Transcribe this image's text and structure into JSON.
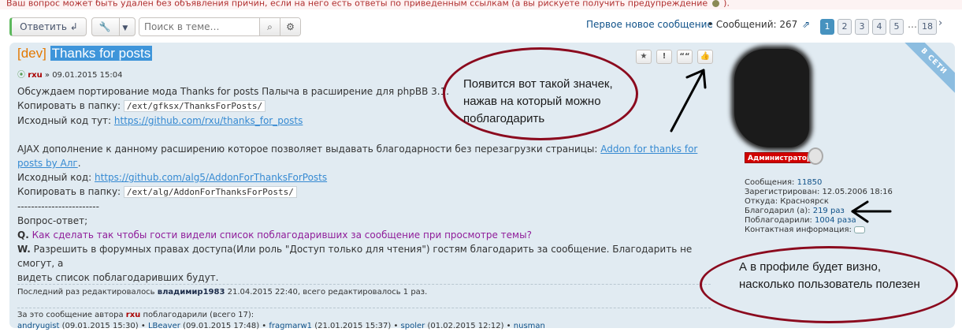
{
  "top_warning": {
    "text_before_icon": "Ваш вопрос может быть удален без объявления причин, если на него есть ответы по приведенным ссылкам (а вы рискуете получить предупреждение",
    "text_after_icon": ")."
  },
  "toolbar": {
    "reply_label": "Ответить",
    "search_placeholder": "Поиск в теме…"
  },
  "pagination": {
    "first_new": "Первое новое сообщение",
    "messages_label": "Сообщений: 267",
    "pages": [
      "1",
      "2",
      "3",
      "4",
      "5",
      "…",
      "18"
    ],
    "active_page": "1"
  },
  "post": {
    "title_prefix": "[dev]",
    "title": "Thanks for posts",
    "author": "rxu",
    "date": "» 09.01.2015 15:04",
    "online_badge": "В СЕТИ",
    "line1": "Обсуждаем портирование мода Thanks for posts Палыча в расширение для phpBB 3.1.",
    "copy_label_1": "Копировать в папку:",
    "copy_path_1": "/ext/gfksx/ThanksForPosts/",
    "source_label_1": "Исходный код тут:",
    "source_link_1": "https://github.com/rxu/thanks_for_posts",
    "ajax_text": "AJAX дополнение к данному расширению которое позволяет выдавать благодарности без перезагрузки страницы:",
    "ajax_link": "Addon for thanks for posts by Алг",
    "source_label_2": "Исходный код:",
    "source_link_2": "https://github.com/alg5/AddonForThanksForPosts",
    "copy_label_2": "Копировать в папку:",
    "copy_path_2": "/ext/alg/AddonForThanksForPosts/",
    "separator": "------------------------",
    "qa_title": "Вопрос-ответ;",
    "q_prefix": "Q.",
    "question": "Как сделать так чтобы гости видели список поблагодаривших за сообщение при просмотре темы?",
    "w_prefix": "W.",
    "answer_1": "Разрешить в форумных правах доступа(Или роль \"Доступ только для чтения\") гостям благодарить за сообщение. Благодарить не смогут, а",
    "answer_2": "видеть список поблагодаривших будут.",
    "edited_prefix": "Последний раз редактировалось",
    "edited_user": "владимир1983",
    "edited_suffix": "21.04.2015 22:40, всего редактировалось 1 раз.",
    "thanks_heading_1": "За это сообщение автора",
    "thanks_heading_user": "rxu",
    "thanks_heading_2": "поблагодарили (всего 17):",
    "thanks_list": [
      {
        "user": "andryugist",
        "date": "(09.01.2015 15:30)"
      },
      {
        "user": "LBeaver",
        "date": "(09.01.2015 17:48)"
      },
      {
        "user": "fragmarw1",
        "date": "(21.01.2015 15:37)"
      },
      {
        "user": "spoler",
        "date": "(01.02.2015 12:12)"
      },
      {
        "user": "nusman",
        "date": ""
      }
    ],
    "buttons": [
      "★",
      "!",
      "““",
      "👍"
    ]
  },
  "profile": {
    "rank": "Администратор",
    "messages_label": "Сообщения:",
    "messages_value": "11850",
    "registered_label": "Зарегистрирован:",
    "registered_value": "12.05.2006 18:16",
    "from_label": "Откуда:",
    "from_value": "Красноярск",
    "thanked_label": "Благодарил (а):",
    "thanked_value": "219 раз",
    "thanked_by_label": "Поблагодарили:",
    "thanked_by_value": "1004 раза",
    "contact_label": "Контактная информация:"
  },
  "annotations": {
    "callout_1": [
      "Появится вот такой значек,",
      "нажав на который можно",
      "поблагодарить"
    ],
    "callout_2": [
      "А в профиле будет визно,",
      "насколько пользователь полезен"
    ]
  },
  "colors": {
    "post_bg": "#e1ebf2",
    "accent_blue": "#4692bf",
    "annotation_red": "#8b0a1e",
    "admin_red": "#d10000"
  }
}
